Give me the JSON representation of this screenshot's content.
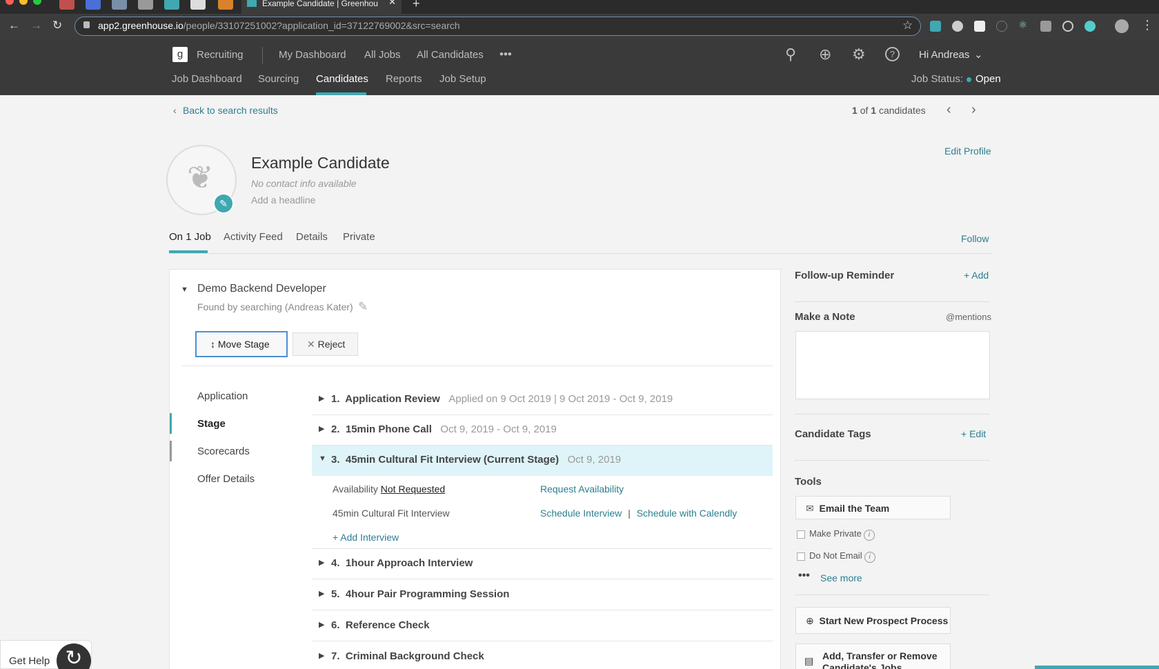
{
  "browser": {
    "tab_title": "Example Candidate | Greenhou",
    "url_host": "app2.greenhouse.io",
    "url_path": "/people/33107251002?application_id=37122769002&src=search"
  },
  "header": {
    "logo_label": "Recruiting",
    "top_nav": [
      "My Dashboard",
      "All Jobs",
      "All Candidates"
    ],
    "more": "•••",
    "user_greeting": "Hi Andreas",
    "sub_nav": [
      "Job Dashboard",
      "Sourcing",
      "Candidates",
      "Reports",
      "Job Setup"
    ],
    "job_status_label": "Job Status:",
    "job_status_value": "Open"
  },
  "pager": {
    "back_label": "Back to search results",
    "current": "1",
    "of": "of",
    "total": "1",
    "unit": "candidates"
  },
  "candidate": {
    "name": "Example Candidate",
    "contact": "No contact info available",
    "headline_placeholder": "Add a headline",
    "edit_profile": "Edit Profile"
  },
  "tabs": [
    "On 1 Job",
    "Activity Feed",
    "Details",
    "Private"
  ],
  "follow": "Follow",
  "job": {
    "title": "Demo Backend Developer",
    "source": "Found by searching (Andreas Kater)",
    "move_stage": "Move Stage",
    "reject": "Reject",
    "left_nav": [
      "Application",
      "Stage",
      "Scorecards",
      "Offer Details"
    ],
    "stages": [
      {
        "n": "1.",
        "name": "Application Review",
        "date": "Applied on 9 Oct 2019 | 9 Oct 2019 - Oct 9, 2019"
      },
      {
        "n": "2.",
        "name": "15min Phone Call",
        "date": "Oct 9, 2019 - Oct 9, 2019"
      },
      {
        "n": "3.",
        "name": "45min Cultural Fit Interview (Current Stage)",
        "date": "Oct 9, 2019"
      },
      {
        "n": "4.",
        "name": "1hour Approach Interview",
        "date": ""
      },
      {
        "n": "5.",
        "name": "4hour Pair Programming Session",
        "date": ""
      },
      {
        "n": "6.",
        "name": "Reference Check",
        "date": ""
      },
      {
        "n": "7.",
        "name": "Criminal Background Check",
        "date": ""
      }
    ],
    "availability_label": "Availability",
    "availability_value": "Not Requested",
    "request_availability": "Request Availability",
    "interview_name": "45min Cultural Fit Interview",
    "schedule_interview": "Schedule Interview",
    "separator": "|",
    "schedule_calendly": "Schedule with Calendly",
    "add_interview": "+ Add Interview"
  },
  "sidebar": {
    "followup_title": "Follow-up Reminder",
    "followup_add": "+ Add",
    "note_title": "Make a Note",
    "mentions": "@mentions",
    "tags_title": "Candidate Tags",
    "tags_edit": "+ Edit",
    "tools_title": "Tools",
    "email_team": "Email the Team",
    "make_private": "Make Private",
    "do_not_email": "Do Not Email",
    "see_more": "See more",
    "start_prospect": "Start New Prospect Process",
    "transfer": "Add, Transfer or Remove Candidate's Jobs"
  },
  "help": {
    "label": "Get Help"
  },
  "colors": {
    "accent": "#3fa8b1",
    "header_bg": "#3a3a3a",
    "current_stage_bg": "#def4f8",
    "link": "#2b7f8f"
  }
}
